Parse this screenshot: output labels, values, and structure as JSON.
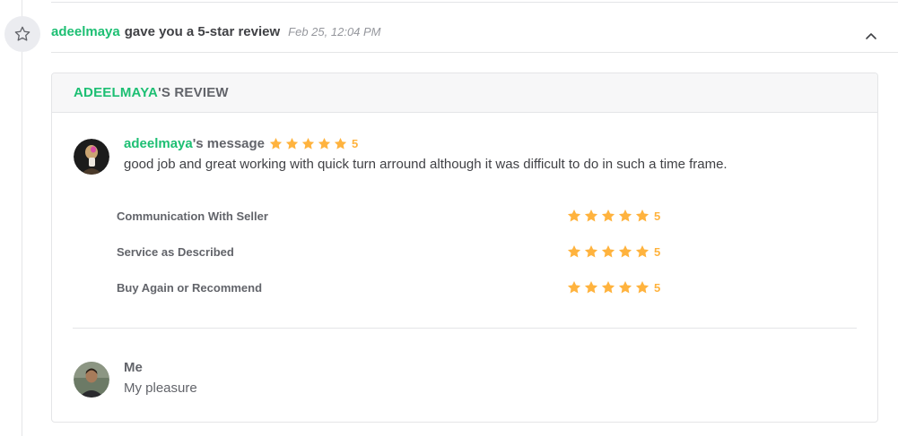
{
  "event": {
    "icon": "star-outline-icon",
    "username": "adeelmaya",
    "action_text": "gave you a 5-star review",
    "timestamp": "Feb 25, 12:04 PM",
    "toggle_icon": "chevron-up-icon"
  },
  "review_card": {
    "header_user": "ADEELMAYA",
    "header_suffix": "'S REVIEW",
    "buyer_message": {
      "avatar_icon": "buyer-avatar",
      "username": "adeelmaya",
      "title_suffix": "'s message",
      "rating": "5",
      "stars_filled": 5,
      "text": "good job and great working with quick turn arround although it was difficult to do in such a time frame."
    },
    "breakdown": [
      {
        "label": "Communication With Seller",
        "rating": "5",
        "stars_filled": 5
      },
      {
        "label": "Service as Described",
        "rating": "5",
        "stars_filled": 5
      },
      {
        "label": "Buy Again or Recommend",
        "rating": "5",
        "stars_filled": 5
      }
    ],
    "seller_reply": {
      "avatar_icon": "seller-avatar",
      "name": "Me",
      "text": "My pleasure"
    }
  },
  "colors": {
    "accent_green": "#1dbf73",
    "star_orange": "#ffb33e",
    "text_dark": "#404145",
    "text_muted": "#62646a",
    "timestamp_gray": "#95979d",
    "border": "#e4e5e7"
  }
}
